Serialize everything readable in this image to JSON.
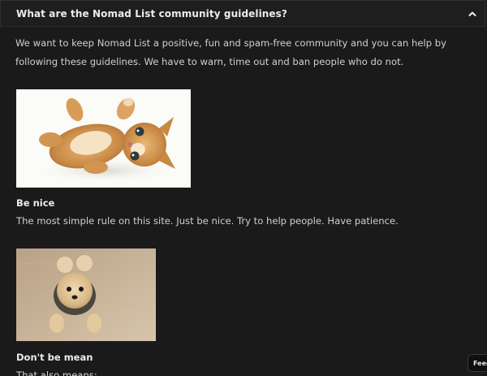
{
  "faq": {
    "question": "What are the Nomad List community guidelines?",
    "intro": "We want to keep Nomad List a positive, fun and spam-free community and you can help by following these guidelines. We have to warn, time out and ban people who do not."
  },
  "rules": [
    {
      "title": "Be nice",
      "text": "The most simple rule on this site. Just be nice. Try to help people. Have patience."
    },
    {
      "title": "Don't be mean",
      "text": "That also means:"
    }
  ],
  "feedback": {
    "label": "Feedback"
  },
  "colors": {
    "background": "#1b1a1b",
    "text": "#d0d0d0",
    "heading": "#ececec"
  }
}
